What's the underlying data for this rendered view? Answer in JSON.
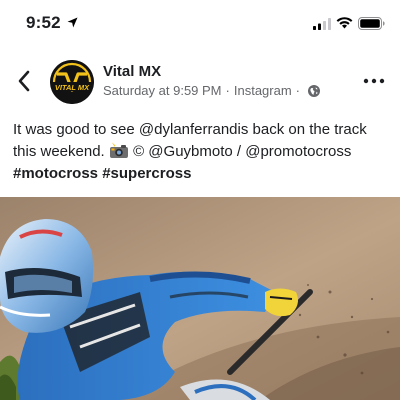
{
  "status_bar": {
    "time": "9:52",
    "colors": {
      "text": "#000000"
    },
    "icons": [
      "location-arrow-icon",
      "cellular-signal-icon",
      "wifi-icon",
      "battery-icon"
    ]
  },
  "header": {
    "page_name": "Vital MX",
    "timestamp": "Saturday at 9:59 PM",
    "separator": "·",
    "source": "Instagram",
    "avatar_text": "VITAL MX",
    "icons": [
      "back-chevron-icon",
      "globe-icon",
      "more-options-icon"
    ]
  },
  "post": {
    "text_main": "It was good to see @dylanferrandis back on the track this weekend.",
    "text_credit": "© @Guybmoto / @promotocross",
    "hashtag_1": "#motocross",
    "hashtag_2": "#supercross",
    "emoji": "camera-with-flash-icon"
  },
  "photo": {
    "subject": "motocross rider in blue gear and helmet cornering on dirt track",
    "colors": {
      "gear": "#2f7fd1",
      "dirt": "#b59a7c",
      "glove": "#f1d33a"
    }
  }
}
